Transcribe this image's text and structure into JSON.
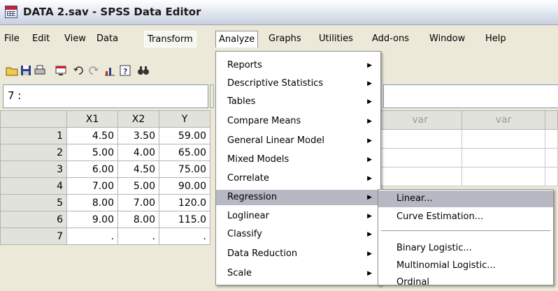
{
  "window": {
    "title": "DATA 2.sav - SPSS Data Editor"
  },
  "menubar": [
    "File",
    "Edit",
    "View",
    "Data",
    "Transform",
    "Analyze",
    "Graphs",
    "Utilities",
    "Add-ons",
    "Window",
    "Help"
  ],
  "cell_ref": "7 :",
  "grid": {
    "columns": [
      "X1",
      "X2",
      "Y"
    ],
    "rows": [
      {
        "n": "1",
        "x1": "4.50",
        "x2": "3.50",
        "y": "59.00"
      },
      {
        "n": "2",
        "x1": "5.00",
        "x2": "4.00",
        "y": "65.00"
      },
      {
        "n": "3",
        "x1": "6.00",
        "x2": "4.50",
        "y": "75.00"
      },
      {
        "n": "4",
        "x1": "7.00",
        "x2": "5.00",
        "y": "90.00"
      },
      {
        "n": "5",
        "x1": "8.00",
        "x2": "7.00",
        "y": "120.0"
      },
      {
        "n": "6",
        "x1": "9.00",
        "x2": "8.00",
        "y": "115.0"
      },
      {
        "n": "7",
        "x1": ".",
        "x2": ".",
        "y": "."
      }
    ],
    "empty_columns": [
      "var",
      "var"
    ]
  },
  "analyze_menu": [
    "Reports",
    "Descriptive Statistics",
    "Tables",
    "Compare Means",
    "General Linear Model",
    "Mixed Models",
    "Correlate",
    "Regression",
    "Loglinear",
    "Classify",
    "Data Reduction",
    "Scale"
  ],
  "regression_submenu": [
    "Linear...",
    "Curve Estimation...",
    "Binary Logistic...",
    "Multinomial Logistic...",
    "Ordinal"
  ],
  "colors": {
    "highlight": "#b7b8c3",
    "menu_bg": "#ece9d8",
    "title_icon_red": "#c8202c"
  }
}
